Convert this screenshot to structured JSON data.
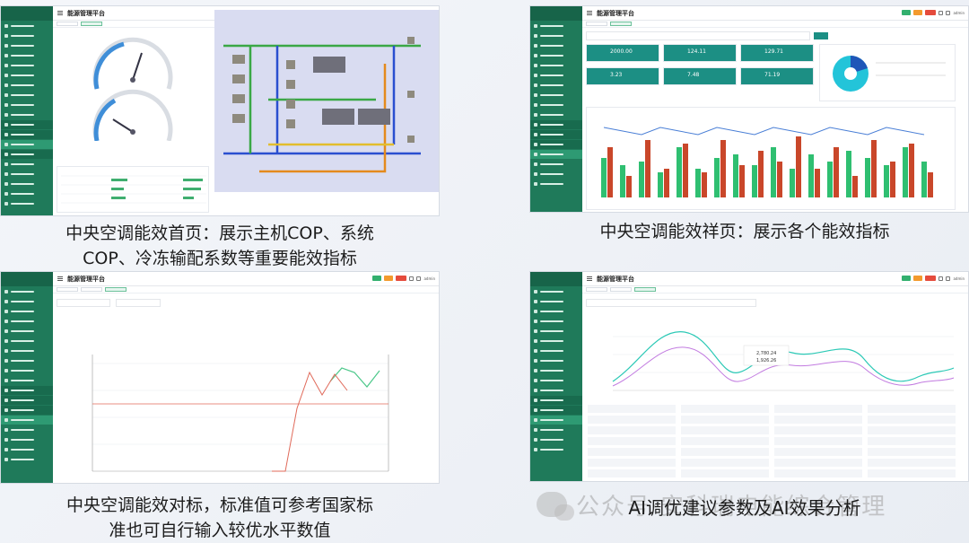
{
  "app_title": "能源管理平台",
  "user": "admin",
  "panels": [
    {
      "id": "home",
      "caption_line1": "中央空调能效首页：展示主机COP、系统",
      "caption_line2": "COP、冷冻输配系数等重要能效指标"
    },
    {
      "id": "detail",
      "caption_line1": "中央空调能效祥页：展示各个能效指标",
      "caption_line2": "",
      "kpis": [
        "2000.00",
        "124.11",
        "129.71",
        "3.23",
        "7.48",
        "71.19"
      ]
    },
    {
      "id": "benchmark",
      "caption_line1": "中央空调能效对标，标准值可参考国家标",
      "caption_line2": "准也可自行输入较优水平数值"
    },
    {
      "id": "ai",
      "caption_line1": "AI调优建议参数及AI效果分析",
      "caption_line2": "",
      "tooltip_values": [
        "2,780.24",
        "1,926.26"
      ]
    }
  ],
  "watermark": "公众号·安科瑞电能综合管理",
  "colors": {
    "sidebar": "#1f7a5a",
    "green_bar": "#2fbf71",
    "red_bar": "#c9472a",
    "line_blue": "#4a7fd6",
    "teal_kpi": "#1c8f84",
    "cyan": "#23c4d9"
  }
}
